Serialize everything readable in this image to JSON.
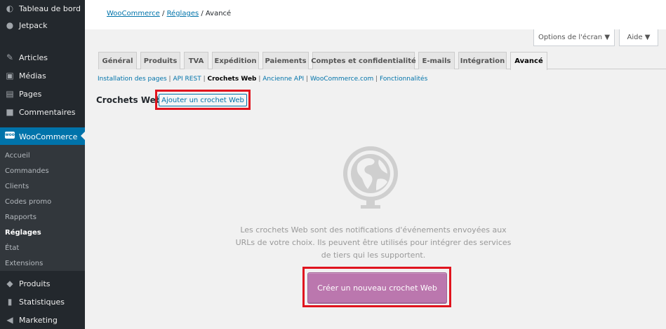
{
  "sidebar": {
    "items": [
      {
        "label": "Tableau de bord",
        "icon": "dashboard-icon"
      },
      {
        "label": "Jetpack",
        "icon": "jetpack-icon"
      },
      {
        "label": "Articles",
        "icon": "pin-icon"
      },
      {
        "label": "Médias",
        "icon": "media-icon"
      },
      {
        "label": "Pages",
        "icon": "pages-icon"
      },
      {
        "label": "Commentaires",
        "icon": "comments-icon"
      },
      {
        "label": "WooCommerce",
        "icon": "woocommerce-icon"
      },
      {
        "label": "Produits",
        "icon": "products-icon"
      },
      {
        "label": "Statistiques",
        "icon": "stats-icon"
      },
      {
        "label": "Marketing",
        "icon": "megaphone-icon"
      }
    ],
    "woo_badge": "woo",
    "submenu": [
      "Accueil",
      "Commandes",
      "Clients",
      "Codes promo",
      "Rapports",
      "Réglages",
      "État",
      "Extensions"
    ]
  },
  "breadcrumb": {
    "part1": "WooCommerce",
    "sep": " / ",
    "part2": "Réglages",
    "current": "Avancé"
  },
  "screen_options": "Options de l'écran ▼",
  "help": "Aide ▼",
  "tabs": [
    "Général",
    "Produits",
    "TVA",
    "Expédition",
    "Paiements",
    "Comptes et confidentialité",
    "E-mails",
    "Intégration",
    "Avancé"
  ],
  "subsub": {
    "items": [
      "Installation des pages",
      "API REST",
      "Crochets Web",
      "Ancienne API",
      "WooCommerce.com",
      "Fonctionnalités"
    ],
    "sep": " | "
  },
  "heading": "Crochets Web",
  "add_button": "Ajouter un crochet Web",
  "empty_message": "Les crochets Web sont des notifications d'événements envoyées aux URLs de votre choix. Ils peuvent être utilisés pour intégrer des services de tiers qui les supportent.",
  "create_button": "Créer un nouveau crochet Web",
  "colors": {
    "sidebar_bg": "#23282d",
    "active_menu": "#0073aa",
    "woo_purple": "#bb77ae",
    "highlight": "#e0141e"
  }
}
